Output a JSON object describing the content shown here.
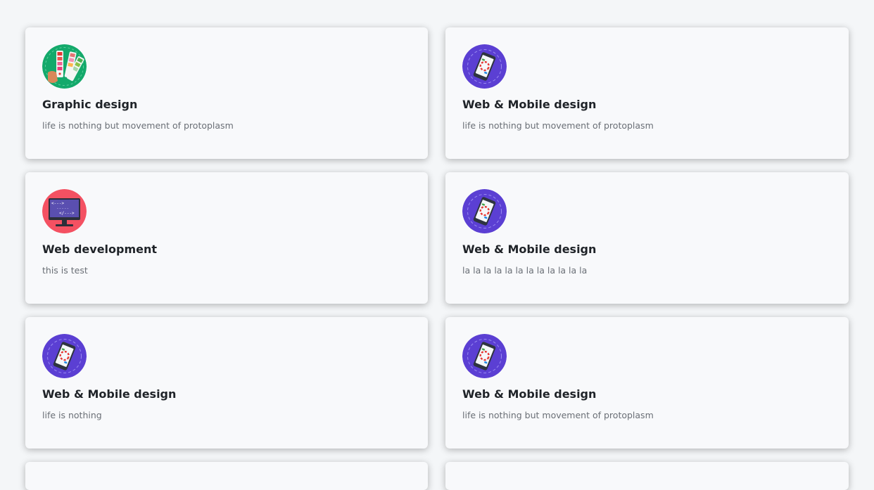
{
  "cards": [
    {
      "icon": "color-palette-icon",
      "title": "Graphic design",
      "description": "life is nothing but movement of protoplasm"
    },
    {
      "icon": "mobile-design-icon",
      "title": "Web & Mobile design",
      "description": "life is nothing but movement of protoplasm"
    },
    {
      "icon": "code-monitor-icon",
      "title": "Web development",
      "description": "this is test"
    },
    {
      "icon": "mobile-design-icon",
      "title": "Web & Mobile design",
      "description": "la la la la la la la la la la la la"
    },
    {
      "icon": "mobile-design-icon",
      "title": "Web & Mobile design",
      "description": "life is nothing"
    },
    {
      "icon": "mobile-design-icon",
      "title": "Web & Mobile design",
      "description": "life is nothing but movement of protoplasm"
    }
  ],
  "monitor_code_lines": [
    "<--->",
    "-----",
    "</--->"
  ]
}
